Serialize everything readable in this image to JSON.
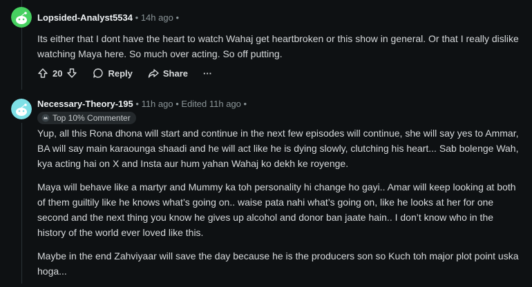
{
  "comments": [
    {
      "username": "Lopsided-Analyst5534",
      "time": "14h ago",
      "body": [
        "Its either that I dont have the heart to watch Wahaj get heartbroken or this show in general. Or that I really dislike watching Maya here. So much over acting. So off putting."
      ],
      "votes": "20",
      "reply_label": "Reply",
      "share_label": "Share",
      "more_label": "···",
      "avatar_color": "#46d160"
    },
    {
      "username": "Necessary-Theory-195",
      "time": "11h ago",
      "edited": "Edited 11h ago",
      "badge": "Top 10% Commenter",
      "body": [
        "Yup, all this Rona dhona will start and continue in the next few episodes will continue, she will say yes to Ammar, BA will say main karaounga shaadi and he will act like he is dying slowly, clutching his heart... Sab bolenge Wah, kya acting hai on X and Insta aur hum yahan Wahaj ko dekh ke royenge.",
        "Maya will behave like a martyr and Mummy ka toh personality hi change ho gayi.. Amar will keep looking at both of them guiltily like he knows what’s going on.. waise pata nahi what’s going on, like he looks at her for one second and the next thing you know he gives up alcohol and donor ban jaate hain.. I don’t know who in the history of the world ever loved like this.",
        "Maybe in the end Zahviyaar will save the day because he is the producers son so Kuch toh major plot point uska hoga..."
      ],
      "avatar_color": "#7ee0e6"
    }
  ],
  "separator": "•"
}
